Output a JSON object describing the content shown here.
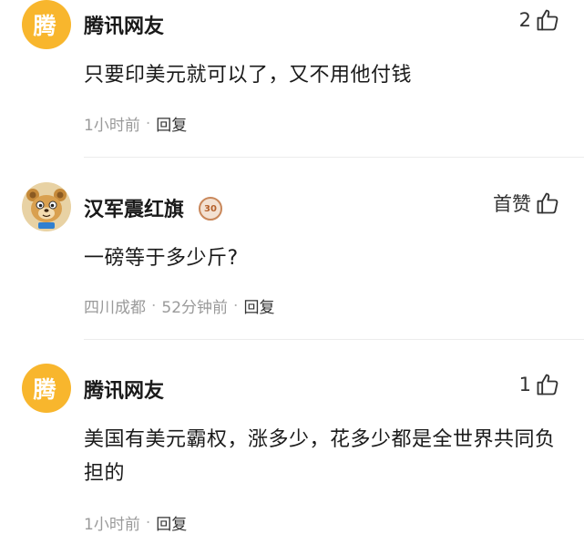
{
  "comments": [
    {
      "avatar_char": "腾",
      "username": "腾讯网友",
      "like_label": "2",
      "content": "只要印美元就可以了，又不用他付钱",
      "time": "1小时前",
      "separator": "·",
      "reply_label": "回复"
    },
    {
      "username": "汉军震红旗",
      "level_badge": "30",
      "like_label": "首赞",
      "content": "一磅等于多少斤?",
      "location": "四川成都",
      "time": "52分钟前",
      "separator": "·",
      "reply_label": "回复"
    },
    {
      "avatar_char": "腾",
      "username": "腾讯网友",
      "like_label": "1",
      "content": "美国有美元霸权，涨多少，花多少都是全世界共同负担的",
      "time": "1小时前",
      "separator": "·",
      "reply_label": "回复"
    }
  ],
  "colors": {
    "tencent_avatar": "#f8b62d",
    "meta_text": "#9a9a9a",
    "level_badge": "#c9875a"
  },
  "icons": {
    "like": "thumbs-up-icon",
    "avatar_bear": "bear-avatar-icon"
  }
}
